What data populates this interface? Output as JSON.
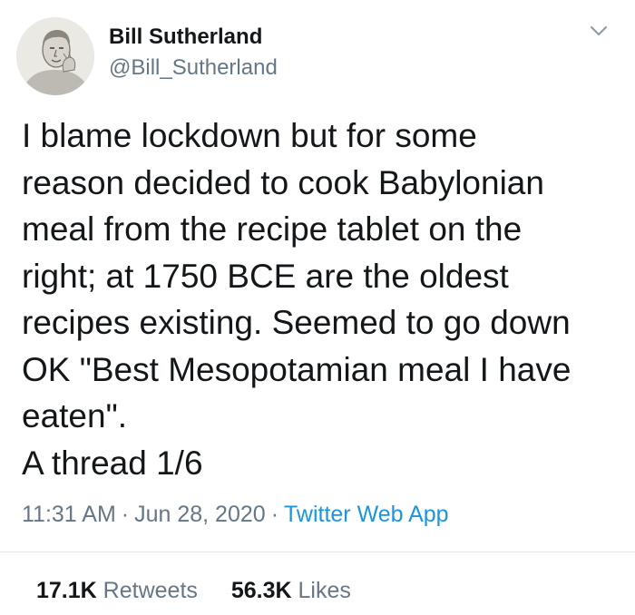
{
  "author": {
    "name": "Bill Sutherland",
    "handle": "@Bill_Sutherland"
  },
  "tweet": {
    "lines": [
      "I blame lockdown but for some",
      "reason decided to cook Babylonian",
      "meal from the recipe tablet on the",
      "right; at 1750 BCE are the oldest",
      "recipes existing. Seemed to go down",
      "OK \"Best Mesopotamian meal I have",
      "eaten\".",
      "A thread 1/6"
    ]
  },
  "meta": {
    "time": "11:31 AM",
    "separator": "·",
    "date": "Jun 28, 2020",
    "source": "Twitter Web App"
  },
  "stats": {
    "retweets_count": "17.1K",
    "retweets_label": "Retweets",
    "likes_count": "56.3K",
    "likes_label": "Likes"
  },
  "colors": {
    "text": "#14171a",
    "secondary": "#657786",
    "link": "#1b95e0",
    "divider": "#e1e8ed"
  },
  "icons": {
    "avatar": "avatar-sketch",
    "menu": "chevron-down-icon"
  }
}
